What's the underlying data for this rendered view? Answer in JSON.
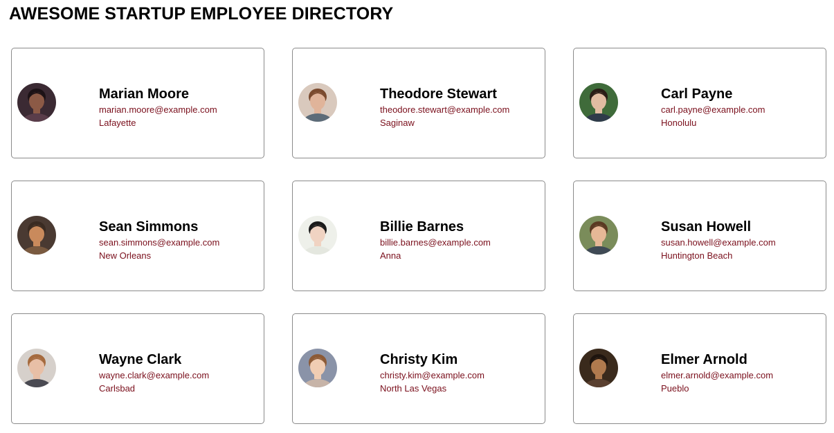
{
  "header": {
    "title": "AWESOME STARTUP EMPLOYEE DIRECTORY"
  },
  "colors": {
    "accent": "#7a0f1c",
    "border": "#8a8a8a",
    "text": "#000000"
  },
  "employees": [
    {
      "name": "Marian Moore",
      "email": "marian.moore@example.com",
      "city": "Lafayette",
      "avatar": {
        "bg": "#3b2a33",
        "skin": "#8c5a46",
        "hair": "#1c1216",
        "shirt": "#5a3d4a"
      }
    },
    {
      "name": "Theodore Stewart",
      "email": "theodore.stewart@example.com",
      "city": "Saginaw",
      "avatar": {
        "bg": "#d9c9bd",
        "skin": "#e0b49a",
        "hair": "#7a4a2e",
        "shirt": "#5c6b78"
      }
    },
    {
      "name": "Carl Payne",
      "email": "carl.payne@example.com",
      "city": "Honolulu",
      "avatar": {
        "bg": "#3f6b3a",
        "skin": "#e1bca2",
        "hair": "#2a1d16",
        "shirt": "#2f3b4a"
      }
    },
    {
      "name": "Sean Simmons",
      "email": "sean.simmons@example.com",
      "city": "New Orleans",
      "avatar": {
        "bg": "#4a3a32",
        "skin": "#c98a5c",
        "hair": "#3a2b22",
        "shirt": "#7a5a40"
      }
    },
    {
      "name": "Billie Barnes",
      "email": "billie.barnes@example.com",
      "city": "Anna",
      "avatar": {
        "bg": "#eef0ea",
        "skin": "#f0d3c2",
        "hair": "#1a1a1a",
        "shirt": "#e4e7df"
      }
    },
    {
      "name": "Susan Howell",
      "email": "susan.howell@example.com",
      "city": "Huntington Beach",
      "avatar": {
        "bg": "#7a8c5a",
        "skin": "#e6b896",
        "hair": "#5a3a22",
        "shirt": "#3f4a55"
      }
    },
    {
      "name": "Wayne Clark",
      "email": "wayne.clark@example.com",
      "city": "Carlsbad",
      "avatar": {
        "bg": "#d6d0cb",
        "skin": "#e8bfa6",
        "hair": "#a56a3e",
        "shirt": "#4a4a52"
      }
    },
    {
      "name": "Christy Kim",
      "email": "christy.kim@example.com",
      "city": "North Las Vegas",
      "avatar": {
        "bg": "#8a93a8",
        "skin": "#f0cdb3",
        "hair": "#8c5a36",
        "shirt": "#c7b4a8"
      }
    },
    {
      "name": "Elmer Arnold",
      "email": "elmer.arnold@example.com",
      "city": "Pueblo",
      "avatar": {
        "bg": "#3a2a1c",
        "skin": "#b07a4e",
        "hair": "#1e140e",
        "shirt": "#5a4030"
      }
    }
  ]
}
